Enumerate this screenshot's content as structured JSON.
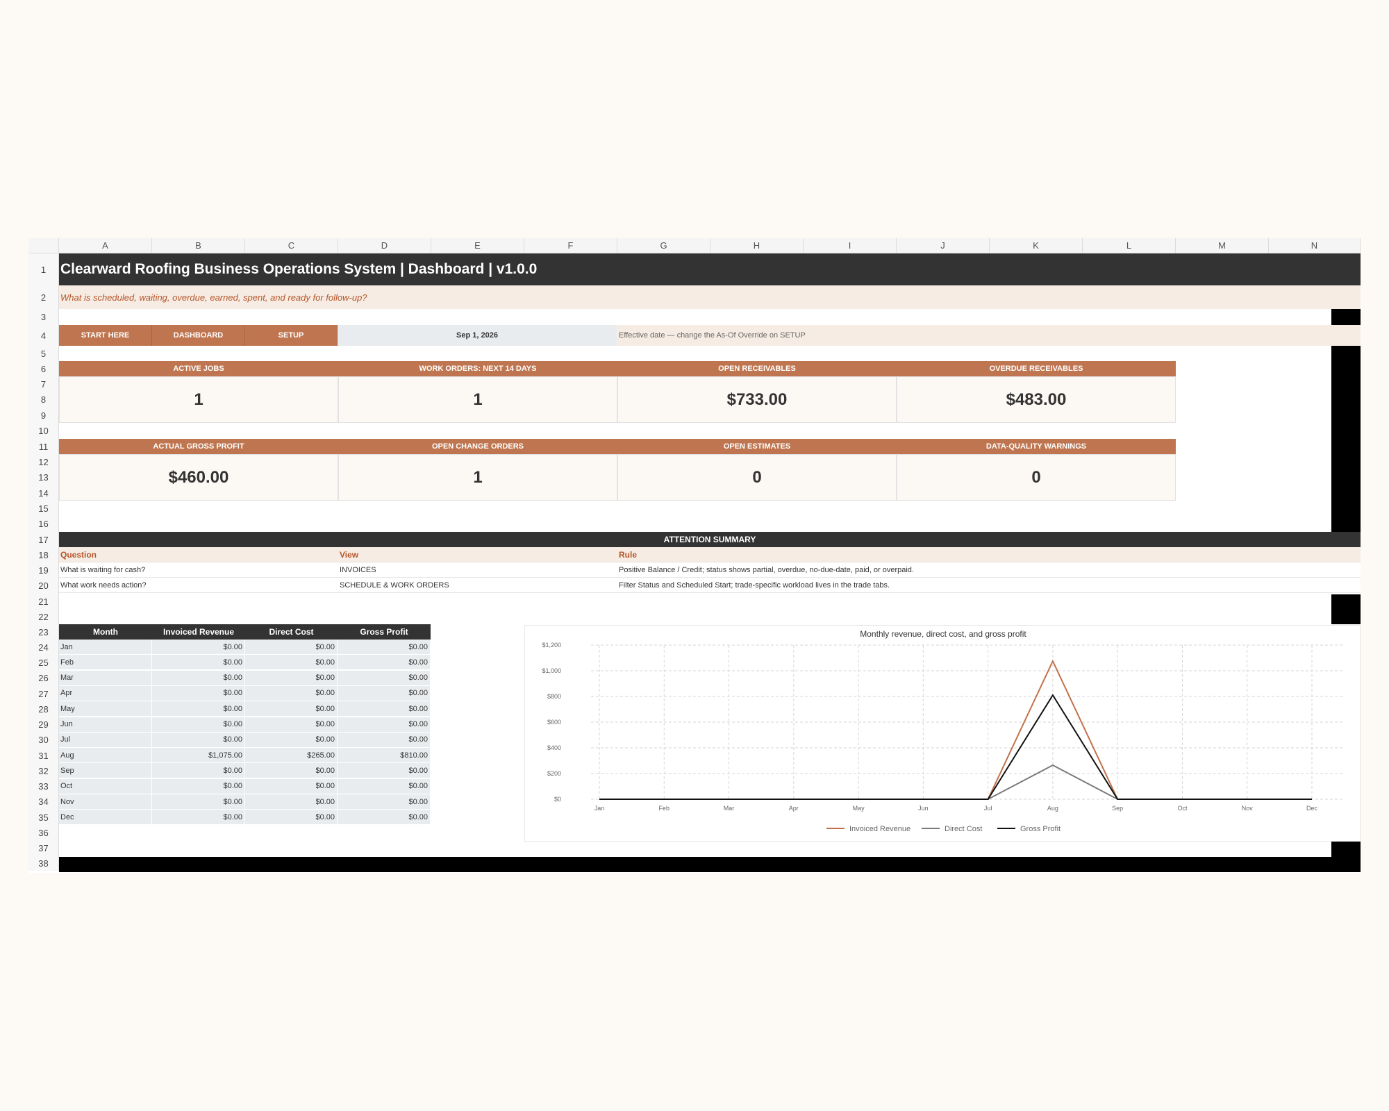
{
  "sheet": {
    "columns": [
      "A",
      "B",
      "C",
      "D",
      "E",
      "F",
      "G",
      "H",
      "I",
      "J",
      "K",
      "L",
      "M",
      "N"
    ],
    "rows": [
      "1",
      "2",
      "3",
      "4",
      "5",
      "6",
      "7",
      "8",
      "9",
      "10",
      "11",
      "12",
      "13",
      "14",
      "15",
      "16",
      "17",
      "18",
      "19",
      "20",
      "21",
      "22",
      "23",
      "24",
      "25",
      "26",
      "27",
      "28",
      "29",
      "30",
      "31",
      "32",
      "33",
      "34",
      "35",
      "36",
      "37",
      "38"
    ]
  },
  "header": {
    "title": "Clearward Roofing Business Operations System | Dashboard | v1.0.0",
    "subtitle": "What is scheduled, waiting, overdue, earned, spent, and ready for follow-up?"
  },
  "nav": {
    "start_here": "START HERE",
    "dashboard": "DASHBOARD",
    "setup": "SETUP",
    "as_of_date": "Sep 1, 2026",
    "as_of_note": "Effective date — change the As-Of Override on SETUP"
  },
  "kpis": [
    {
      "label": "ACTIVE JOBS",
      "value": "1"
    },
    {
      "label": "WORK ORDERS: NEXT 14 DAYS",
      "value": "1"
    },
    {
      "label": "OPEN RECEIVABLES",
      "value": "$733.00"
    },
    {
      "label": "OVERDUE RECEIVABLES",
      "value": "$483.00"
    },
    {
      "label": "ACTUAL GROSS PROFIT",
      "value": "$460.00"
    },
    {
      "label": "OPEN CHANGE ORDERS",
      "value": "1"
    },
    {
      "label": "OPEN ESTIMATES",
      "value": "0"
    },
    {
      "label": "DATA-QUALITY WARNINGS",
      "value": "0"
    }
  ],
  "attention": {
    "title": "ATTENTION SUMMARY",
    "headers": [
      "Question",
      "View",
      "Rule"
    ],
    "rows": [
      [
        "What is waiting for cash?",
        "INVOICES",
        "Positive Balance / Credit; status shows partial, overdue, no-due-date, paid, or overpaid."
      ],
      [
        "What work needs action?",
        "SCHEDULE & WORK ORDERS",
        "Filter Status and Scheduled Start; trade-specific workload lives in the trade tabs."
      ]
    ]
  },
  "monthly_table": {
    "headers": [
      "Month",
      "Invoiced Revenue",
      "Direct Cost",
      "Gross Profit"
    ],
    "rows": [
      [
        "Jan",
        "$0.00",
        "$0.00",
        "$0.00"
      ],
      [
        "Feb",
        "$0.00",
        "$0.00",
        "$0.00"
      ],
      [
        "Mar",
        "$0.00",
        "$0.00",
        "$0.00"
      ],
      [
        "Apr",
        "$0.00",
        "$0.00",
        "$0.00"
      ],
      [
        "May",
        "$0.00",
        "$0.00",
        "$0.00"
      ],
      [
        "Jun",
        "$0.00",
        "$0.00",
        "$0.00"
      ],
      [
        "Jul",
        "$0.00",
        "$0.00",
        "$0.00"
      ],
      [
        "Aug",
        "$1,075.00",
        "$265.00",
        "$810.00"
      ],
      [
        "Sep",
        "$0.00",
        "$0.00",
        "$0.00"
      ],
      [
        "Oct",
        "$0.00",
        "$0.00",
        "$0.00"
      ],
      [
        "Nov",
        "$0.00",
        "$0.00",
        "$0.00"
      ],
      [
        "Dec",
        "$0.00",
        "$0.00",
        "$0.00"
      ]
    ]
  },
  "colors": {
    "accent": "#bf7650",
    "dark": "#333333",
    "revenue_line": "#c0714a",
    "cost_line": "#7a7a7a",
    "profit_line": "#111111"
  },
  "chart_data": {
    "type": "line",
    "title": "Monthly revenue, direct cost, and gross profit",
    "categories": [
      "Jan",
      "Feb",
      "Mar",
      "Apr",
      "May",
      "Jun",
      "Jul",
      "Aug",
      "Sep",
      "Oct",
      "Nov",
      "Dec"
    ],
    "series": [
      {
        "name": "Invoiced Revenue",
        "values": [
          0,
          0,
          0,
          0,
          0,
          0,
          0,
          1075,
          0,
          0,
          0,
          0
        ]
      },
      {
        "name": "Direct Cost",
        "values": [
          0,
          0,
          0,
          0,
          0,
          0,
          0,
          265,
          0,
          0,
          0,
          0
        ]
      },
      {
        "name": "Gross Profit",
        "values": [
          0,
          0,
          0,
          0,
          0,
          0,
          0,
          810,
          0,
          0,
          0,
          0
        ]
      }
    ],
    "ylim": [
      0,
      1200
    ],
    "yticks": [
      "$0",
      "$200",
      "$400",
      "$600",
      "$800",
      "$1,000",
      "$1,200"
    ],
    "ytick_values": [
      0,
      200,
      400,
      600,
      800,
      1000,
      1200
    ],
    "grid": true,
    "legend": "bottom"
  }
}
